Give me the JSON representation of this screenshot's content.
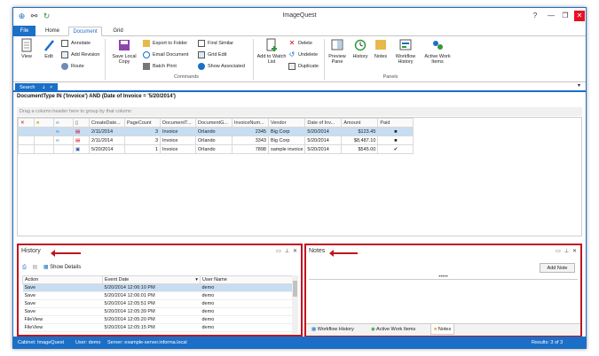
{
  "app": {
    "title": "ImageQuest"
  },
  "ribbon_tabs": [
    {
      "label": "File"
    },
    {
      "label": "Home"
    },
    {
      "label": "Document"
    },
    {
      "label": "Grid"
    }
  ],
  "ribbon": {
    "view": "View",
    "edit": "Edit",
    "annotate": "Annotate",
    "add_revision": "Add Revision",
    "route": "Route",
    "save_local_copy": "Save Local Copy",
    "export_to_folder": "Export to Folder",
    "email_document": "Email Document",
    "batch_print": "Batch Print",
    "find_similar": "Find Similar",
    "grid_edit": "Grid Edit",
    "show_associated": "Show Associated",
    "add_to_watch_list": "Add to Watch List",
    "delete": "Delete",
    "undelete": "Undelete",
    "duplicate": "Duplicate",
    "commands_label": "Commands",
    "preview_pane": "Preview Pane",
    "history": "History",
    "notes": "Notes",
    "workflow_history": "Workflow History",
    "active_work_items": "Active Work Items",
    "panels_label": "Panels"
  },
  "search_tab": {
    "label": "Search",
    "pin": "⇣",
    "close": "×"
  },
  "query": "DocumentType IN ('Invoice') AND (Date of Invoice = '5/20/2014')",
  "group_hint": "Drag a column header here to group by that column",
  "grid": {
    "columns": [
      "CreateDate...",
      "PageCount",
      "DocumentT...",
      "DocumentG...",
      "InvoiceNum...",
      "Vendor",
      "Date of Inv...",
      "Amount",
      "Paid"
    ],
    "rows": [
      {
        "create": "2/11/2014",
        "pages": "3",
        "type": "Invoice",
        "group": "Orlando",
        "inv": "2345",
        "vendor": "Big Corp",
        "date": "5/20/2014",
        "amount": "$123.45",
        "paid": "■"
      },
      {
        "create": "2/11/2014",
        "pages": "3",
        "type": "Invoice",
        "group": "Orlando",
        "inv": "3343",
        "vendor": "Big Corp",
        "date": "5/20/2014",
        "amount": "$8,487.10",
        "paid": "■"
      },
      {
        "create": "5/20/2014",
        "pages": "1",
        "type": "Invoice",
        "group": "Orlando",
        "inv": "7898",
        "vendor": "sample invoice",
        "date": "5/20/2014",
        "amount": "$545.00",
        "paid": "✔"
      }
    ]
  },
  "history": {
    "title": "History",
    "show_details": "Show Details",
    "columns": [
      "Action",
      "Event Date",
      "User Name"
    ],
    "rows": [
      {
        "action": "Save",
        "date": "5/20/2014 12:06:10 PM",
        "user": "demo"
      },
      {
        "action": "Save",
        "date": "5/20/2014 12:06:01 PM",
        "user": "demo"
      },
      {
        "action": "Save",
        "date": "5/20/2014 12:05:51 PM",
        "user": "demo"
      },
      {
        "action": "Save",
        "date": "5/20/2014 12:05:39 PM",
        "user": "demo"
      },
      {
        "action": "FileView",
        "date": "5/20/2014 12:05:20 PM",
        "user": "demo"
      },
      {
        "action": "FileView",
        "date": "5/20/2014 12:05:15 PM",
        "user": "demo"
      }
    ]
  },
  "notes_panel": {
    "title": "Notes",
    "add_note": "Add Note",
    "dots": "•••••",
    "tabs": [
      "Workflow History",
      "Active Work Items",
      "Notes"
    ]
  },
  "status": {
    "cabinet": "Cabinet: ImageQuest",
    "user": "User: demo",
    "server": "Server: example-server.informa.local",
    "results": "Results: 3 of 3"
  },
  "colors": {
    "accent": "#1c6fc7",
    "highlight": "#c0151f",
    "selection": "#c7ddf2"
  }
}
